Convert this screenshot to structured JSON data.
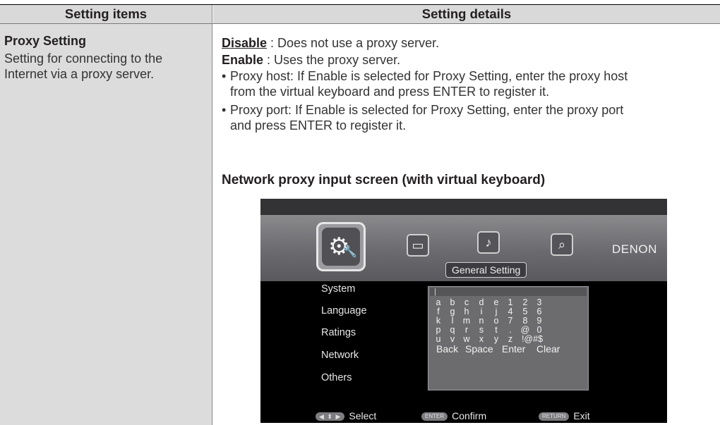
{
  "table": {
    "header_left": "Setting items",
    "header_right": "Setting details"
  },
  "item": {
    "title": "Proxy Setting",
    "description_lines": [
      "Setting for connecting to the",
      "Internet via a proxy server."
    ]
  },
  "details": {
    "disable_term": "Disable",
    "disable_text": " : Does not use a proxy server.",
    "enable_term": "Enable",
    "enable_text": " : Uses the proxy server.",
    "bullet_char": "•",
    "bullets": [
      {
        "line1": "Proxy host: If Enable is selected for Proxy Setting, enter the proxy host",
        "line2": "from the virtual keyboard and press ENTER to register it."
      },
      {
        "line1": "Proxy port: If Enable is selected for Proxy Setting, enter the proxy port",
        "line2": "and press ENTER to register it."
      }
    ],
    "caption": "Network proxy input screen (with virtual keyboard)"
  },
  "screen": {
    "brand": "DENON",
    "band_label": "General Setting",
    "menu": [
      "System",
      "Language",
      "Ratings",
      "Network",
      "Others"
    ],
    "input_caret": "|",
    "keyboard_rows": [
      [
        "a",
        "b",
        "c",
        "d",
        "e",
        "1",
        "2",
        "3"
      ],
      [
        "f",
        "g",
        "h",
        "i",
        "j",
        "4",
        "5",
        "6"
      ],
      [
        "k",
        "l",
        "m",
        "n",
        "o",
        "7",
        "8",
        "9"
      ],
      [
        "p",
        "q",
        "r",
        "s",
        "t",
        ".",
        "@",
        "0"
      ],
      [
        "u",
        "v",
        "w",
        "x",
        "y",
        "z",
        "!@#$"
      ]
    ],
    "keyboard_functions": [
      "Back",
      "Space",
      "Enter",
      "Clear"
    ],
    "footer": {
      "select_button": "◀ ⬍ ▶",
      "select_label": "Select",
      "confirm_button": "ENTER",
      "confirm_label": "Confirm",
      "exit_button": "RETURN",
      "exit_label": "Exit"
    },
    "icons": [
      "general-setting-icon",
      "tv-icon",
      "music-icon",
      "book-icon"
    ]
  }
}
